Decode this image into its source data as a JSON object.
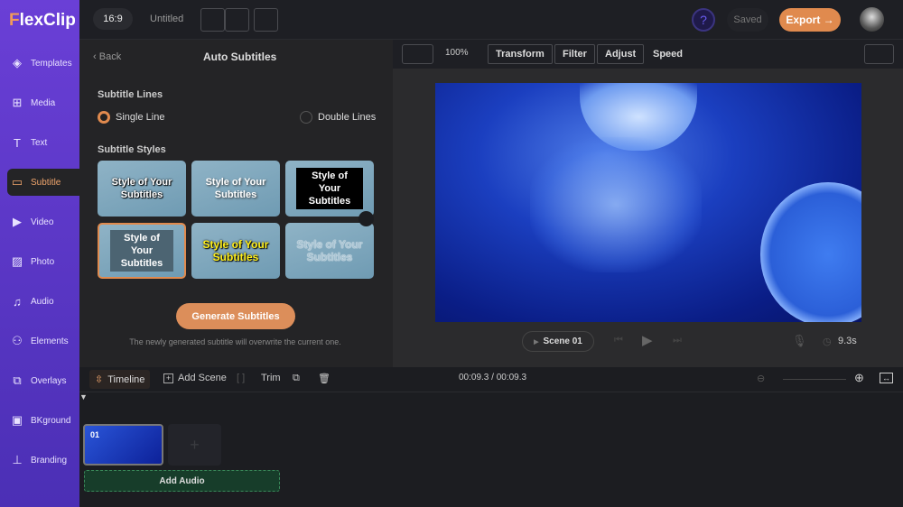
{
  "app": {
    "logo": "FlexClip",
    "ratio": "16:9",
    "title": "Untitled",
    "saved": "Saved",
    "export": "Export →",
    "accent": "#e08a4e"
  },
  "sidebar": {
    "items": [
      {
        "label": "Templates",
        "icon": "layers-icon"
      },
      {
        "label": "Media",
        "icon": "folder-plus-icon"
      },
      {
        "label": "Text",
        "icon": "text-icon"
      },
      {
        "label": "Subtitle",
        "icon": "subtitle-icon"
      },
      {
        "label": "Video",
        "icon": "video-icon"
      },
      {
        "label": "Photo",
        "icon": "photo-icon"
      },
      {
        "label": "Audio",
        "icon": "music-icon"
      },
      {
        "label": "Elements",
        "icon": "shapes-icon"
      },
      {
        "label": "Overlays",
        "icon": "overlay-icon"
      },
      {
        "label": "BKground",
        "icon": "background-icon"
      },
      {
        "label": "Branding",
        "icon": "stamp-icon"
      }
    ]
  },
  "panel": {
    "back": "Back",
    "title": "Auto Subtitles",
    "lines_heading": "Subtitle Lines",
    "single": "Single Line",
    "double": "Double Lines",
    "styles_heading": "Subtitle Styles",
    "style_text": "Style of Your Subtitles",
    "generate": "Generate Subtitles",
    "note": "The newly generated subtitle will overwrite the current one."
  },
  "toolbar": {
    "zoom": "100%",
    "transform": "Transform",
    "filter": "Filter",
    "adjust": "Adjust",
    "speed": "Speed"
  },
  "player": {
    "scene": "Scene 01",
    "duration": "9.3s"
  },
  "timeline": {
    "timeline": "Timeline",
    "add_scene": "Add Scene",
    "trim": "Trim",
    "time": "00:09.3 / 00:09.3",
    "scene_num": "01",
    "add_audio": "Add Audio"
  }
}
